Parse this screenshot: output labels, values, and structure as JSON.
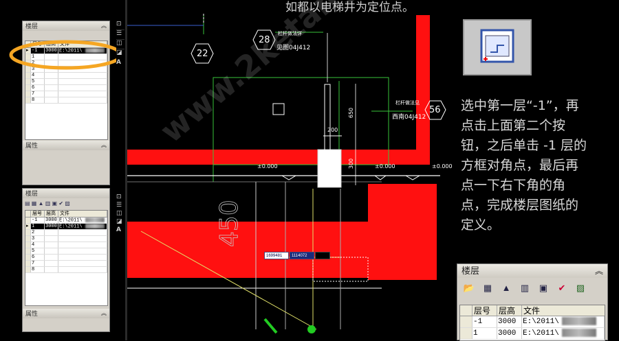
{
  "top_caption": "如都以电梯井为定位点。",
  "instruction": [
    "选中第一层“-1”，再",
    "点击上面第二个按",
    "钮，之后单击 -1 层的",
    "方框对角点，最后再",
    "点一下右下角的角",
    "点，完成楼层图纸的",
    "定义。"
  ],
  "left_panel_top": {
    "title": "楼层",
    "columns": [
      "层号",
      "层高",
      "文件"
    ],
    "rows": [
      {
        "num": "-1",
        "height": "3000",
        "file": "E:\\2011\\"
      },
      {
        "num": "1",
        "height": "",
        "file": ""
      },
      {
        "num": "2",
        "height": "",
        "file": ""
      },
      {
        "num": "3",
        "height": "",
        "file": ""
      },
      {
        "num": "4",
        "height": "",
        "file": ""
      },
      {
        "num": "5",
        "height": "",
        "file": ""
      },
      {
        "num": "6",
        "height": "",
        "file": ""
      },
      {
        "num": "7",
        "height": "",
        "file": ""
      },
      {
        "num": "8",
        "height": "",
        "file": ""
      }
    ],
    "props_title": "属性"
  },
  "left_panel_bottom": {
    "columns": [
      "层号",
      "层高",
      "文件"
    ],
    "rows": [
      {
        "num": "-1",
        "height": "3000",
        "file": "E:\\2011\\"
      },
      {
        "num": "1",
        "height": "3000",
        "file": "E:\\2011\\"
      },
      {
        "num": "2",
        "height": "",
        "file": ""
      },
      {
        "num": "3",
        "height": "",
        "file": ""
      },
      {
        "num": "4",
        "height": "",
        "file": ""
      },
      {
        "num": "5",
        "height": "",
        "file": ""
      },
      {
        "num": "6",
        "height": "",
        "file": ""
      },
      {
        "num": "7",
        "height": "",
        "file": ""
      },
      {
        "num": "8",
        "height": "",
        "file": ""
      }
    ],
    "props_title": "属性"
  },
  "zoom_panel": {
    "title": "楼层",
    "columns": [
      "层号",
      "层高",
      "文件"
    ],
    "rows": [
      {
        "num": "-1",
        "height": "3000",
        "file": "E:\\2011\\"
      },
      {
        "num": "1",
        "height": "3000",
        "file": "E:\\2011\\"
      }
    ]
  },
  "cad": {
    "marker_22": "22",
    "marker_28": "28",
    "marker_56": "56",
    "note1_line1": "栏杆做法详",
    "note1_line2": "见图04J412",
    "note2_line1": "栏杆做法见",
    "note2_line2": "西南04J412",
    "dim_200": "200",
    "dim_650": "650",
    "dim_300": "300",
    "elev1": "±0.000",
    "elev2": "±0.000",
    "elev3": "±0.000",
    "big_dim": "450",
    "coord_x": "1699481",
    "coord_y": "1114072",
    "watermark": "www.2ketang.com",
    "side_A": "A"
  },
  "colors": {
    "red": "#ff1010",
    "green": "#22cc22",
    "highlight": "#f5a623",
    "yellow": "#d8d860"
  }
}
